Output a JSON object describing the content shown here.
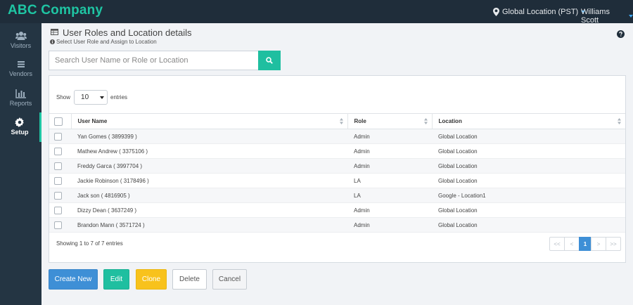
{
  "header": {
    "brand": "ABC Company",
    "location_label": "Global Location (PST)",
    "user_name": "Williams Scott",
    "icons": {
      "location": "map-pin-icon",
      "dropdown": "chevron-down-icon"
    },
    "colors": {
      "topbar": "#1f2d3a",
      "brand": "#1fc5a3"
    }
  },
  "sidebar": {
    "items": [
      {
        "label": "Visitors",
        "icon": "users-icon",
        "active": false
      },
      {
        "label": "Vendors",
        "icon": "list-icon",
        "active": false
      },
      {
        "label": "Reports",
        "icon": "bar-chart-icon",
        "active": false
      },
      {
        "label": "Setup",
        "icon": "gear-icon",
        "active": true
      }
    ]
  },
  "page": {
    "title": "User Roles and Location details",
    "subtitle": "Select User Role and Assign to Location",
    "help_icon": "question-circle-icon"
  },
  "search": {
    "placeholder": "Search User Name or Role or Location",
    "value": "",
    "button_icon": "search-icon"
  },
  "table": {
    "show_label": "Show",
    "page_size": "10",
    "entries_label": "entries",
    "columns": [
      "User Name",
      "Role",
      "Location"
    ],
    "rows": [
      {
        "name": "Yan Gomes ( 3899399 )",
        "role": "Admin",
        "location": "Global Location"
      },
      {
        "name": "Mathew Andrew ( 3375106 )",
        "role": "Admin",
        "location": "Global Location"
      },
      {
        "name": "Freddy Garca ( 3997704 )",
        "role": "Admin",
        "location": "Global Location"
      },
      {
        "name": "Jackie Robinson ( 3178496 )",
        "role": "LA",
        "location": "Global Location"
      },
      {
        "name": "Jack son ( 4816905 )",
        "role": "LA",
        "location": "Google - Location1"
      },
      {
        "name": "Dizzy Dean ( 3637249 )",
        "role": "Admin",
        "location": "Global Location"
      },
      {
        "name": "Brandon Mann ( 3571724 )",
        "role": "Admin",
        "location": "Global Location"
      }
    ],
    "info": "Showing 1 to 7 of 7 entries",
    "pagination": {
      "first": "<<",
      "prev": "<",
      "current": "1",
      "next": ">",
      "last": ">>"
    }
  },
  "actions": {
    "create": "Create New",
    "edit": "Edit",
    "clone": "Clone",
    "delete": "Delete",
    "cancel": "Cancel",
    "colors": {
      "primary": "#3e8fd6",
      "success": "#1fbfa0",
      "warning": "#f8c21c"
    }
  }
}
